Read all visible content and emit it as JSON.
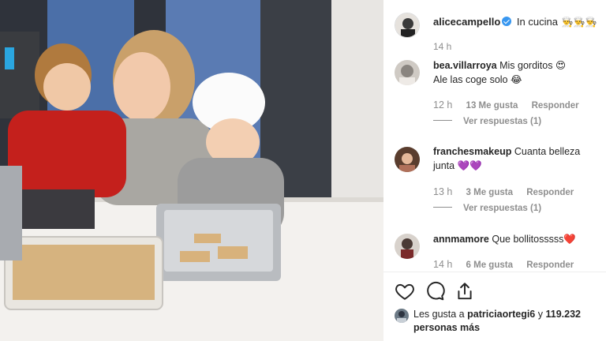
{
  "post": {
    "owner": {
      "username": "alicecampello",
      "verified": true,
      "caption": "In cucina",
      "caption_emoji": "👨‍🍳👨‍🍳👨‍🍳",
      "time": "14 h"
    },
    "comments": [
      {
        "username": "bea.villarroya",
        "text": "Mis gorditos",
        "emoji": "😍",
        "text2": "Ale las coge solo",
        "emoji2": "😂",
        "time": "12 h",
        "likes": "13 Me gusta",
        "reply_label": "Responder",
        "view_replies": "Ver respuestas (1)"
      },
      {
        "username": "franchesmakeup",
        "text": "Cuanta belleza junta",
        "emoji": "💜💜",
        "time": "13 h",
        "likes": "3 Me gusta",
        "reply_label": "Responder",
        "view_replies": "Ver respuestas (1)"
      },
      {
        "username": "annmamore",
        "text": "Que bollitosssss",
        "emoji": "❤️",
        "time": "14 h",
        "likes": "6 Me gusta",
        "reply_label": "Responder"
      }
    ],
    "liked_by": {
      "prefix": "Les gusta a",
      "user": "patriciaortegi6",
      "connector": "y",
      "count": "119.232 personas más"
    }
  },
  "icons": {
    "like": "heart-icon",
    "comment": "comment-bubble-icon",
    "share": "share-icon",
    "verified": "verified-badge-icon"
  },
  "colors": {
    "verified": "#3897f0",
    "meta_text": "#8e8e8e",
    "text": "#262626"
  }
}
